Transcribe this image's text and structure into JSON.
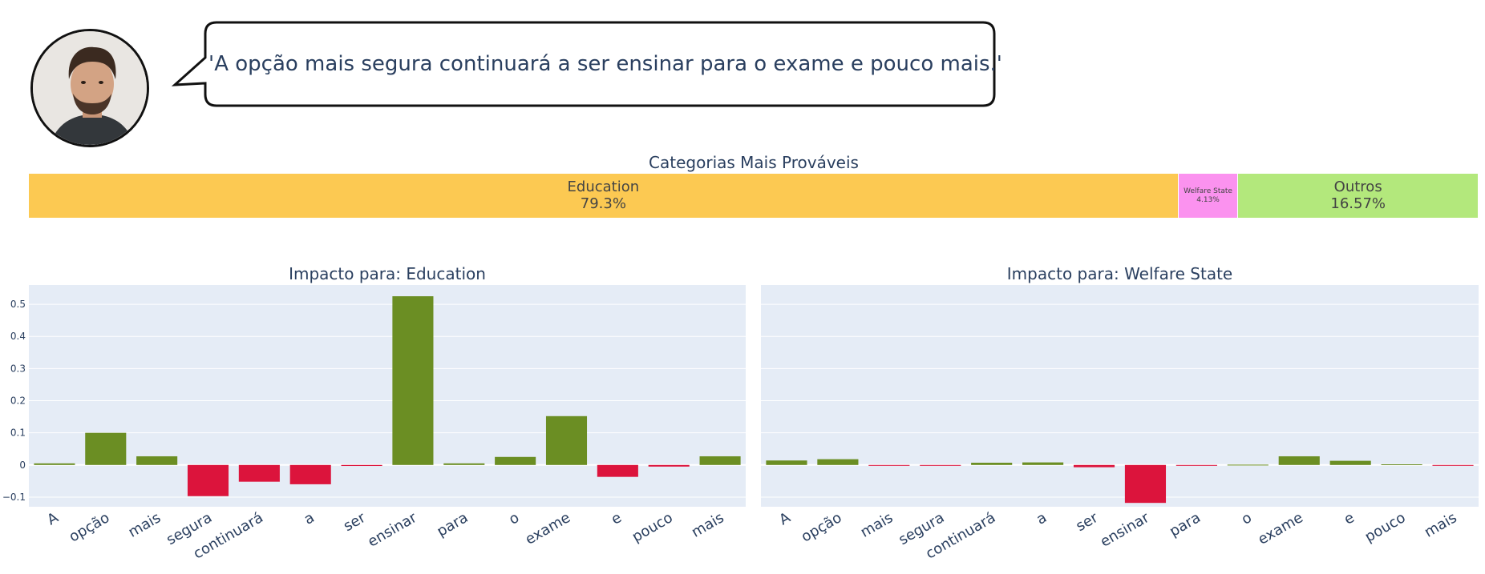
{
  "quote": "'A opção mais segura continuará a ser ensinar para o exame e pouco mais.'",
  "colors": {
    "positive": "#6b8e23",
    "negative": "#dc143c",
    "plot_bg": "#e5ecf6",
    "text": "#2a3f5f"
  },
  "probabilities": {
    "title": "Categorias Mais Prováveis",
    "segments": [
      {
        "name": "Education",
        "percent_label": "79.3%",
        "value": 79.3,
        "color": "#fcc952"
      },
      {
        "name": "Welfare State",
        "percent_label": "4.13%",
        "value": 4.13,
        "color": "#fb92ef"
      },
      {
        "name": "Outros",
        "percent_label": "16.57%",
        "value": 16.57,
        "color": "#b3e87c"
      }
    ]
  },
  "chart_data": [
    {
      "type": "bar",
      "title": "Impacto para: Education",
      "categories": [
        "A",
        "opção",
        "mais",
        "segura",
        "continuará",
        "a",
        "ser",
        "ensinar",
        "para",
        "o",
        "exame",
        "e",
        "pouco",
        "mais"
      ],
      "values": [
        0.005,
        0.1,
        0.027,
        -0.097,
        -0.052,
        -0.06,
        -0.003,
        0.525,
        0.005,
        0.025,
        0.152,
        -0.037,
        -0.005,
        0.027
      ],
      "ylim": [
        -0.13,
        0.56
      ],
      "yticks": [
        -0.1,
        0,
        0.1,
        0.2,
        0.3,
        0.4,
        0.5
      ],
      "ytick_labels": [
        "−0.1",
        "0",
        "0.1",
        "0.2",
        "0.3",
        "0.4",
        "0.5"
      ],
      "grid": true
    },
    {
      "type": "bar",
      "title": "Impacto para: Welfare State",
      "categories": [
        "A",
        "opção",
        "mais",
        "segura",
        "continuará",
        "a",
        "ser",
        "ensinar",
        "para",
        "o",
        "exame",
        "e",
        "pouco",
        "mais"
      ],
      "values": [
        0.014,
        0.018,
        -0.001,
        -0.001,
        0.007,
        0.008,
        -0.007,
        -0.118,
        -0.001,
        0.001,
        0.027,
        0.013,
        0.002,
        -0.001
      ],
      "ylim": [
        -0.13,
        0.56
      ],
      "grid": true
    }
  ]
}
